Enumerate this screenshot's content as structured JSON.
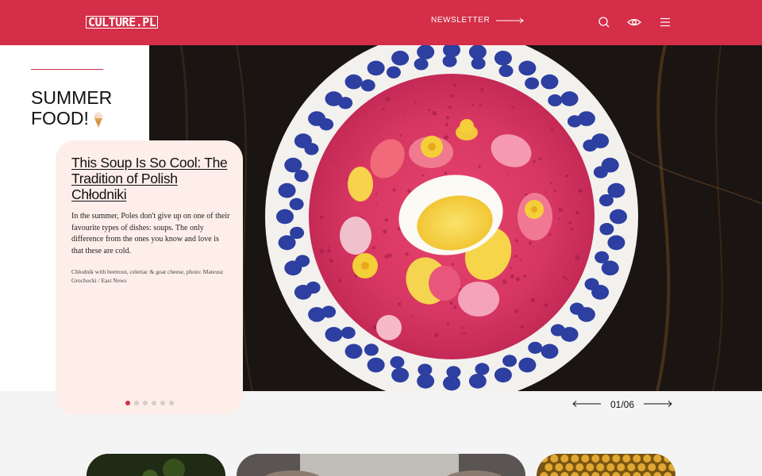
{
  "header": {
    "logo": "CULTURE.PL",
    "newsletter_label": "NEWSLETTER",
    "icons": [
      "search-icon",
      "eye-icon",
      "menu-icon"
    ],
    "background_color": "#d42e48"
  },
  "section": {
    "title_line1": "SUMMER",
    "title_line2": "FOOD!",
    "title_icon": "ice-cream-icon"
  },
  "article": {
    "title": "This Soup Is So Cool: The Tradition of Polish Chłodniki",
    "description": "In the summer, Poles don't give up on one of their favourite types of dishes: soups. The only difference from the ones you know and love is that these are cold.",
    "caption": "Chłodnik with beetroot, celeriac & goat cheese, photo: Mateusz Grochocki / East News",
    "slide_count": 6,
    "active_slide": 1
  },
  "pager": {
    "counter": "01/06"
  },
  "colors": {
    "accent": "#d42e48",
    "card_bg": "#fdeeea",
    "page_bg": "#f4f4f4"
  }
}
